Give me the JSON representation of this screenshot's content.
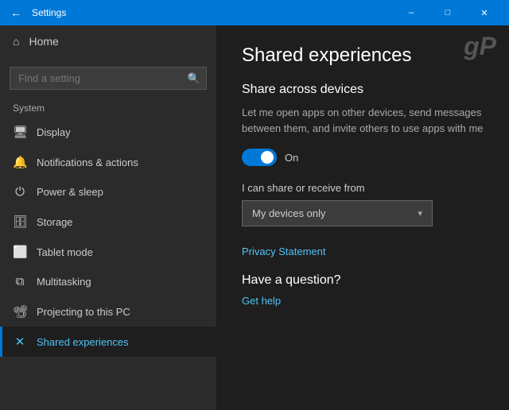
{
  "titlebar": {
    "title": "Settings",
    "back_label": "←",
    "minimize_label": "–",
    "maximize_label": "□",
    "close_label": "✕"
  },
  "sidebar": {
    "search_placeholder": "Find a setting",
    "search_icon": "🔍",
    "home_label": "Home",
    "section_label": "System",
    "items": [
      {
        "id": "display",
        "label": "Display",
        "icon": "🖥"
      },
      {
        "id": "notifications",
        "label": "Notifications & actions",
        "icon": "🔔"
      },
      {
        "id": "power",
        "label": "Power & sleep",
        "icon": "⏻"
      },
      {
        "id": "storage",
        "label": "Storage",
        "icon": "💾"
      },
      {
        "id": "tablet",
        "label": "Tablet mode",
        "icon": "⬜"
      },
      {
        "id": "multitasking",
        "label": "Multitasking",
        "icon": "⧉"
      },
      {
        "id": "projecting",
        "label": "Projecting to this PC",
        "icon": "📽"
      },
      {
        "id": "shared",
        "label": "Shared experiences",
        "icon": "✕",
        "active": true
      }
    ]
  },
  "content": {
    "watermark": "gP",
    "page_title": "Shared experiences",
    "section_title": "Share across devices",
    "section_desc": "Let me open apps on other devices, send messages between them, and invite others to use apps with me",
    "toggle_state": "On",
    "share_from_label": "I can share or receive from",
    "dropdown_value": "My devices only",
    "dropdown_arrow": "▾",
    "privacy_link": "Privacy Statement",
    "have_question": "Have a question?",
    "get_help_link": "Get help"
  }
}
